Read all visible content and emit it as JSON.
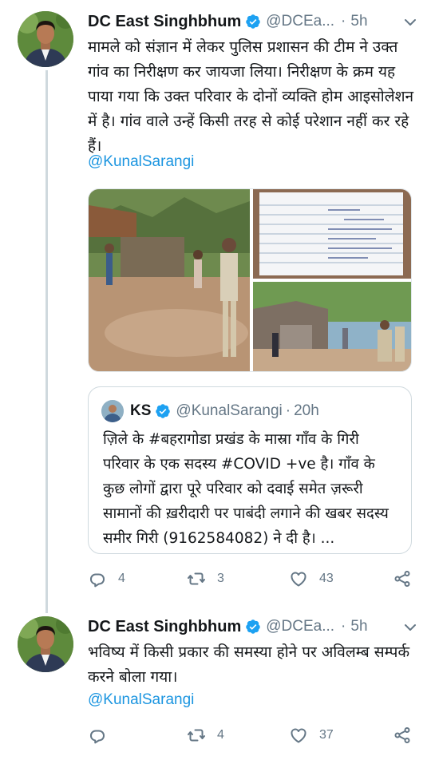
{
  "tweets": [
    {
      "author": {
        "name": "DC East Singhbhum",
        "handle": "@DCEa...",
        "time": "5h"
      },
      "text": "मामले को संज्ञान में लेकर पुलिस प्रशासन की टीम ने उक्त गांव का निरीक्षण कर जायजा लिया। निरीक्षण के क्रम यह पाया गया कि उक्त परिवार के दोनों व्यक्ति होम आइसोलेशन में है। गांव वाले उन्हें किसी तरह से कोई परेशान नहीं कर रहे हैं।",
      "mention": "@KunalSarangi",
      "quote": {
        "author": {
          "name": "KS",
          "handle": "@KunalSarangi",
          "time": "20h"
        },
        "text": "ज़िले के #बहरागोडा प्रखंड के मास्रा गाँव के गिरी परिवार के एक सदस्य  #COVID +ve है। गाँव के कुछ लोगों द्वारा पूरे परिवार को दवाई समेत ज़रूरी सामानों की ख़रीदारी पर पाबंदी लगाने की खबर सदस्य समीर गिरी (9162584082) ने दी है। ..."
      },
      "actions": {
        "replies": "4",
        "retweets": "3",
        "likes": "43"
      }
    },
    {
      "author": {
        "name": "DC East Singhbhum",
        "handle": "@DCEa...",
        "time": "5h"
      },
      "text": "भविष्य में किसी प्रकार की समस्या होने पर अविलम्ब सम्पर्क करने बोला गया।",
      "mention": "@KunalSarangi",
      "actions": {
        "replies": "",
        "retweets": "4",
        "likes": "37"
      }
    }
  ],
  "colors": {
    "link": "#1b95e0",
    "secondary": "#657786",
    "verified": "#1da1f2"
  },
  "icons": [
    "verified-badge-icon",
    "chevron-down-icon",
    "reply-icon",
    "retweet-icon",
    "like-icon",
    "share-icon"
  ]
}
